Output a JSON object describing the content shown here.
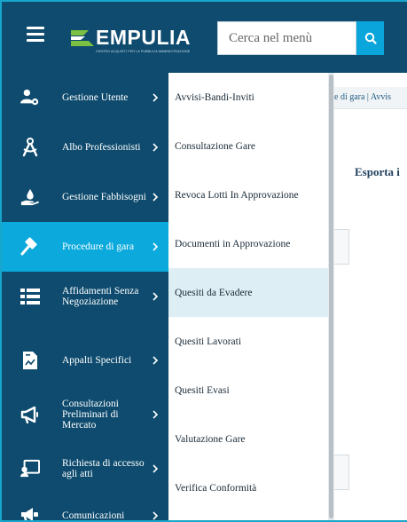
{
  "header": {
    "logo_text": "EMPULIA",
    "logo_subtitle": "CENTRO ACQUISTI PER LA PUBBLICA AMMINISTRAZIONE",
    "search_placeholder": "Cerca nel menù"
  },
  "background": {
    "breadcrumb": "e di gara | Avvis",
    "tab_label": "Esporta i"
  },
  "sidebar": {
    "items": [
      {
        "label": "Gestione Utente",
        "icon": "users-gear-icon"
      },
      {
        "label": "Albo Professionisti",
        "icon": "compass-icon"
      },
      {
        "label": "Gestione Fabbisogni",
        "icon": "hand-drop-icon"
      },
      {
        "label": "Procedure di gara",
        "icon": "gavel-icon",
        "active": true
      },
      {
        "label": "Affidamenti Senza Negoziazione",
        "icon": "list-icon"
      },
      {
        "label": "Appalti Specifici",
        "icon": "document-chart-icon"
      },
      {
        "label": "Consultazioni Preliminari di Mercato",
        "icon": "megaphone-icon"
      },
      {
        "label": "Richiesta di accesso agli atti",
        "icon": "presentation-user-icon"
      },
      {
        "label": "Comunicazioni",
        "icon": "megaphone-alt-icon"
      }
    ]
  },
  "submenu": {
    "items": [
      {
        "label": "Avvisi-Bandi-Inviti"
      },
      {
        "label": "Consultazione Gare"
      },
      {
        "label": "Revoca Lotti In Approvazione"
      },
      {
        "label": "Documenti in Approvazione"
      },
      {
        "label": "Quesiti da Evadere",
        "hover": true
      },
      {
        "label": "Quesiti Lavorati"
      },
      {
        "label": "Quesiti Evasi"
      },
      {
        "label": "Valutazione Gare"
      },
      {
        "label": "Verifica Conformità"
      }
    ]
  },
  "colors": {
    "header_bg": "#0e4b6e",
    "active_item": "#0ba9dc",
    "submenu_hover": "#ddeef4",
    "search_button": "#0aa6db"
  }
}
